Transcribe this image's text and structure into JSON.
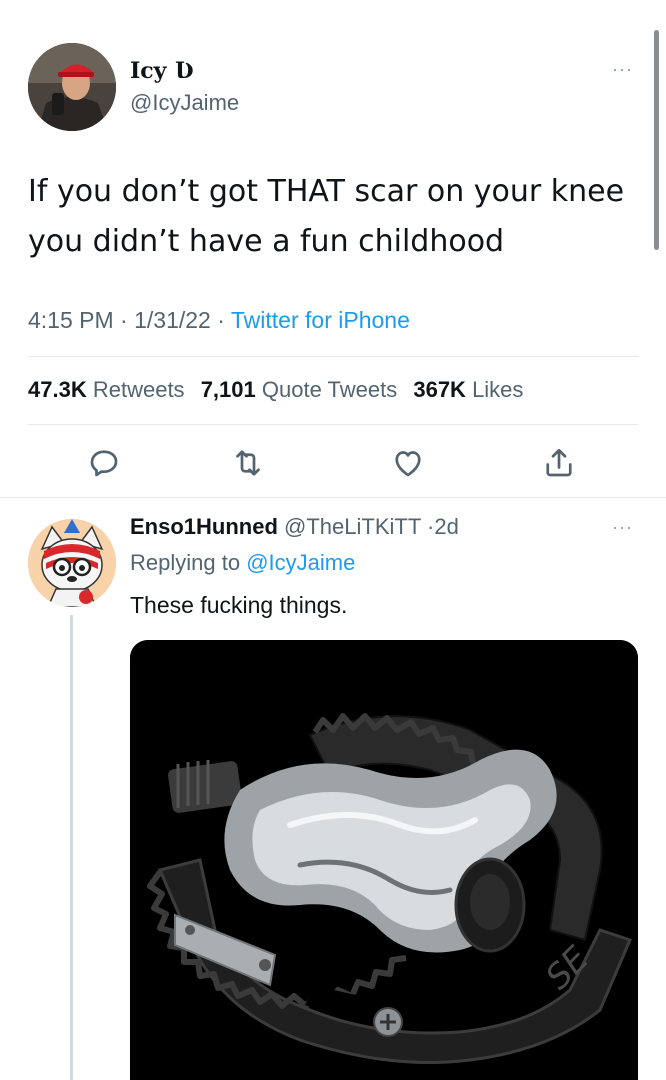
{
  "tweet": {
    "display_name": "Icy Ʋ",
    "handle": "@IcyJaime",
    "text": "If you don’t got THAT scar on your knee you didn’t have a fun childhood",
    "time": "4:15 PM",
    "date": "1/31/22",
    "client": "Twitter for iPhone",
    "separator": "·",
    "stats": {
      "retweets_count": "47.3K",
      "retweets_label": "Retweets",
      "quotes_count": "7,101",
      "quotes_label": "Quote Tweets",
      "likes_count": "367K",
      "likes_label": "Likes"
    },
    "more_label": "···"
  },
  "reply": {
    "display_name": "Enso1Hunned",
    "handle": "@TheLiTKiTT",
    "age": "2d",
    "replying_label": "Replying to",
    "replying_handle": "@IcyJaime",
    "text": "These fucking things.",
    "media_brand_text": "SE",
    "more_label": "···"
  },
  "icons": [
    "reply-icon",
    "retweet-icon",
    "like-icon",
    "share-icon",
    "more-icon"
  ],
  "colors": {
    "link": "#1d9bf0",
    "muted": "#536471",
    "text": "#0f1419"
  }
}
